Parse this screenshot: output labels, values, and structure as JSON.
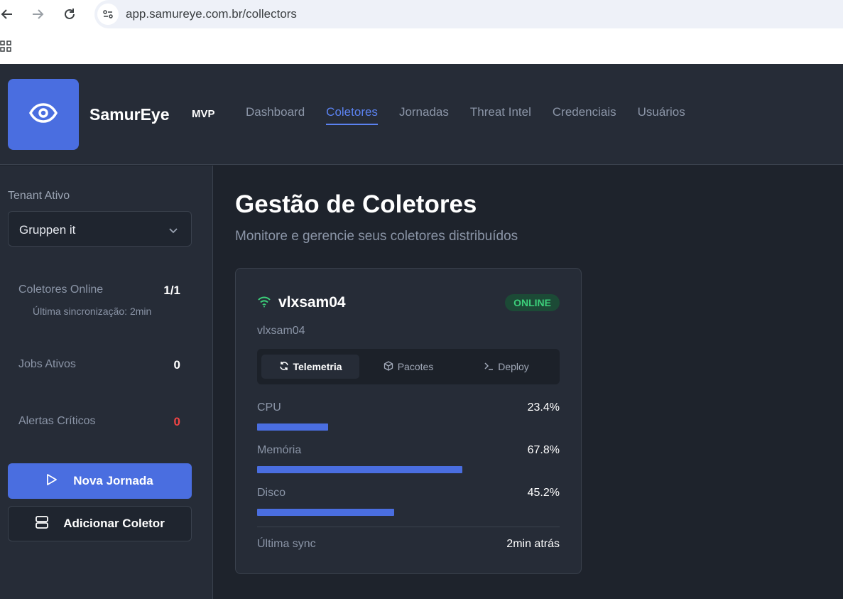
{
  "browser": {
    "url": "app.samureye.com.br/collectors"
  },
  "header": {
    "brand": "SamurEye",
    "badge": "MVP",
    "nav": [
      {
        "label": "Dashboard",
        "active": false
      },
      {
        "label": "Coletores",
        "active": true
      },
      {
        "label": "Jornadas",
        "active": false
      },
      {
        "label": "Threat Intel",
        "active": false
      },
      {
        "label": "Credenciais",
        "active": false
      },
      {
        "label": "Usuários",
        "active": false
      }
    ]
  },
  "sidebar": {
    "tenant_label": "Tenant Ativo",
    "tenant_value": "Gruppen it",
    "stats": {
      "collectors_label": "Coletores Online",
      "collectors_value": "1/1",
      "last_sync": "Última sincronização: 2min",
      "jobs_label": "Jobs Ativos",
      "jobs_value": "0",
      "alerts_label": "Alertas Críticos",
      "alerts_value": "0"
    },
    "buttons": {
      "new_journey": "Nova Jornada",
      "add_collector": "Adicionar Coletor"
    }
  },
  "main": {
    "title": "Gestão de Coletores",
    "subtitle": "Monitore e gerencie seus coletores distribuídos",
    "collector": {
      "name": "vlxsam04",
      "hostname": "vlxsam04",
      "status": "ONLINE",
      "tabs": [
        "Telemetria",
        "Pacotes",
        "Deploy"
      ],
      "active_tab": "Telemetria",
      "metrics": [
        {
          "label": "CPU",
          "value": "23.4%",
          "fraction": 0.234
        },
        {
          "label": "Memória",
          "value": "67.8%",
          "fraction": 0.678
        },
        {
          "label": "Disco",
          "value": "45.2%",
          "fraction": 0.452
        }
      ],
      "sync_label": "Última sync",
      "sync_value": "2min atrás"
    }
  },
  "colors": {
    "accent": "#4a6ee0",
    "online": "#3ccf7a",
    "alert": "#ef4444"
  },
  "icons": [
    "back-arrow-icon",
    "forward-arrow-icon",
    "reload-icon",
    "site-settings-icon",
    "apps-grid-icon",
    "eye-icon",
    "chevron-down-icon",
    "play-icon",
    "server-icon",
    "wifi-icon",
    "refresh-icon",
    "package-icon",
    "terminal-icon"
  ]
}
